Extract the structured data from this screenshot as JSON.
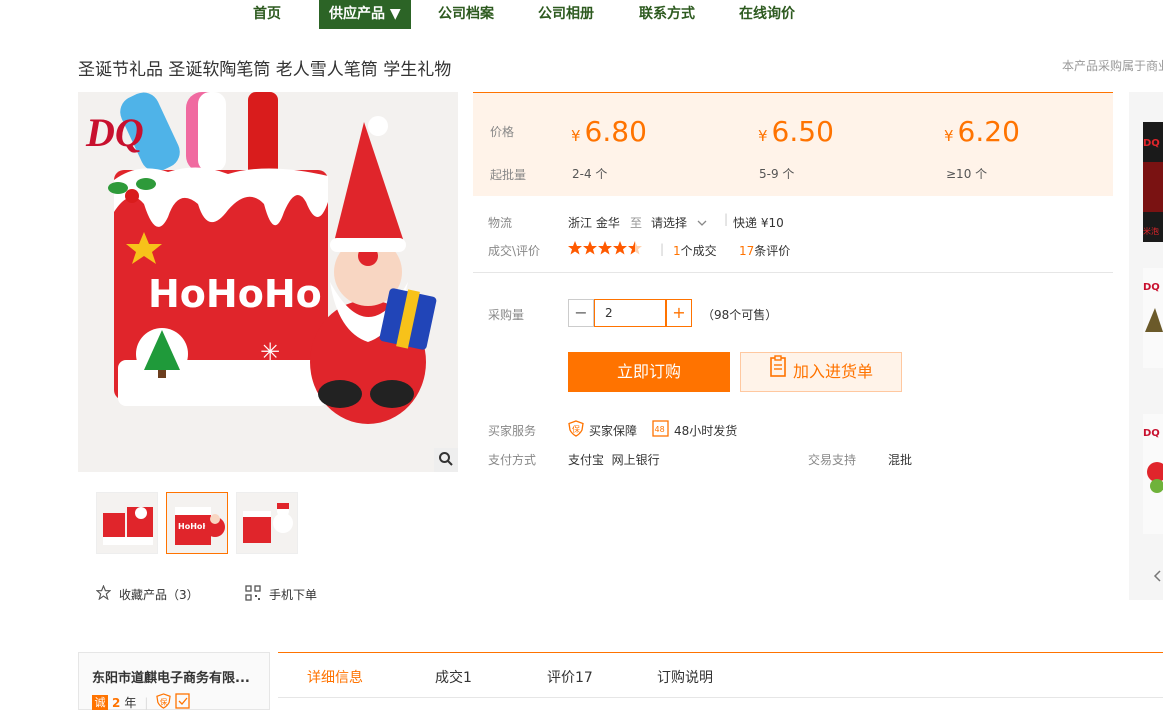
{
  "nav": {
    "items": [
      {
        "label": "首页"
      },
      {
        "label": "供应产品 ▼"
      },
      {
        "label": "公司档案"
      },
      {
        "label": "公司相册"
      },
      {
        "label": "联系方式"
      },
      {
        "label": "在线询价"
      }
    ]
  },
  "product": {
    "title": "圣诞节礼品 圣诞软陶笔筒 老人雪人笔筒 学生礼物",
    "top_note": "本产品采购属于商业",
    "image_text": "HoHoHo",
    "logo_text": "DQ"
  },
  "price": {
    "price_label": "价格",
    "qty_label": "起批量",
    "currency": "¥",
    "tiers": [
      {
        "price": "6.80",
        "qty": "2-4 个"
      },
      {
        "price": "6.50",
        "qty": "5-9 个"
      },
      {
        "price": "6.20",
        "qty": "≥10 个"
      }
    ]
  },
  "logistics": {
    "label": "物流",
    "from": "浙江 金华",
    "to_word": "至",
    "select": "请选择",
    "express": "快递 ¥10"
  },
  "deal": {
    "label": "成交\\评价",
    "rating": 4.5,
    "deals_num": "1",
    "deals_text": "个成交",
    "reviews_num": "17",
    "reviews_text": "条评价"
  },
  "purchase": {
    "label": "采购量",
    "quantity": "2",
    "minus": "−",
    "plus": "+",
    "available": "（98个可售）",
    "buy_label": "立即订购",
    "cart_label": "加入进货单"
  },
  "services": {
    "label": "买家服务",
    "items": [
      "买家保障",
      "48小时发货"
    ],
    "pay_label": "支付方式",
    "pay_methods": "支付宝  网上银行",
    "trade_label": "交易支持",
    "trade_value": "混批"
  },
  "utils": {
    "favorite": "收藏产品（3）",
    "mobile": "手机下单"
  },
  "company": {
    "name": "东阳市道麒电子商务有限...",
    "badge": "诚",
    "years": "2",
    "years_unit": "年"
  },
  "tabs": [
    {
      "label": "详细信息"
    },
    {
      "label": "成交1"
    },
    {
      "label": "评价17"
    },
    {
      "label": "订购说明"
    }
  ],
  "colors": {
    "accent": "#ff7300",
    "nav_green": "#2c6426"
  }
}
